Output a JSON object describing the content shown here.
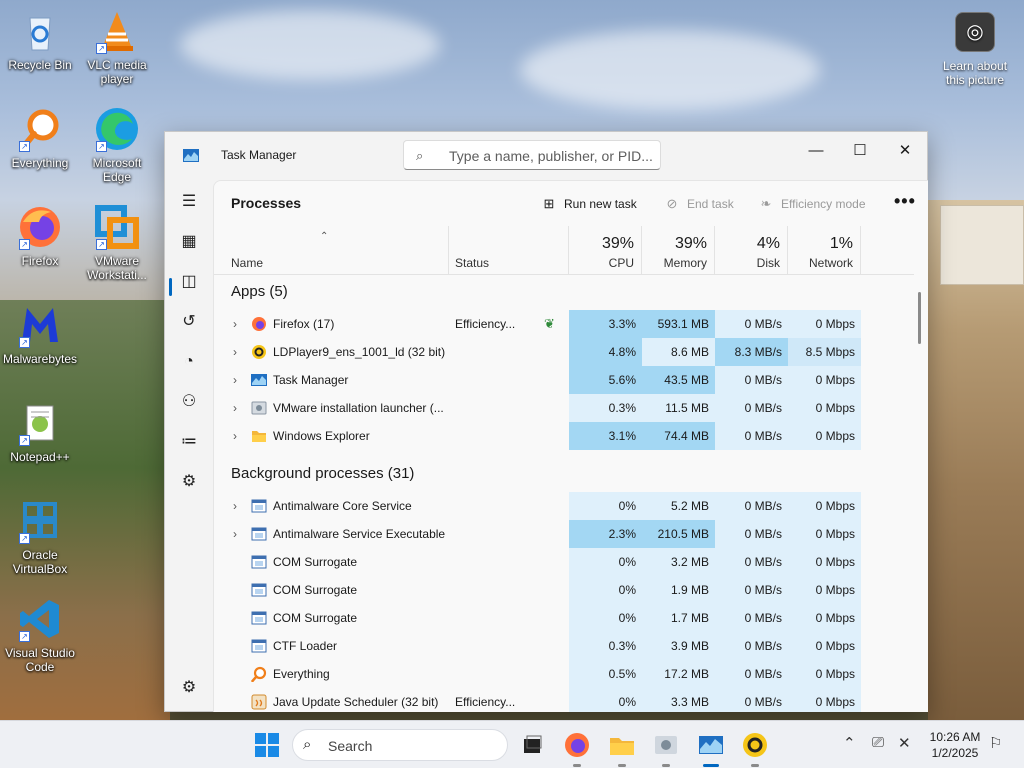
{
  "desktop": {
    "icons": [
      {
        "label": "Recycle Bin"
      },
      {
        "label": "VLC media player"
      },
      {
        "label": "Everything"
      },
      {
        "label": "Microsoft Edge"
      },
      {
        "label": "Firefox"
      },
      {
        "label": "VMware Workstati..."
      },
      {
        "label": "Malwarebytes"
      },
      {
        "label": "Notepad++"
      },
      {
        "label": "Oracle VirtualBox"
      },
      {
        "label": "Visual Studio Code"
      }
    ],
    "learn_picture": "Learn about this picture"
  },
  "window": {
    "title": "Task Manager",
    "search_placeholder": "Type a name, publisher, or PID...",
    "controls": {
      "minimize": "—",
      "maximize": "☐",
      "close": "✕"
    }
  },
  "toolbar": {
    "page_title": "Processes",
    "run_new_task": "Run new task",
    "end_task": "End task",
    "efficiency_mode": "Efficiency mode",
    "more": "•••"
  },
  "columns": {
    "name": "Name",
    "status": "Status",
    "cpu": {
      "pct": "39%",
      "label": "CPU"
    },
    "memory": {
      "pct": "39%",
      "label": "Memory"
    },
    "disk": {
      "pct": "4%",
      "label": "Disk"
    },
    "network": {
      "pct": "1%",
      "label": "Network"
    }
  },
  "groups": {
    "apps": "Apps (5)",
    "background": "Background processes (31)"
  },
  "apps": [
    {
      "name": "Firefox (17)",
      "status": "Efficiency...",
      "cpu": "3.3%",
      "memory": "593.1 MB",
      "disk": "0 MB/s",
      "network": "0 Mbps",
      "icon": "firefox-icon"
    },
    {
      "name": "LDPlayer9_ens_1001_ld (32 bit)",
      "status": "",
      "cpu": "4.8%",
      "memory": "8.6 MB",
      "disk": "8.3 MB/s",
      "network": "8.5 Mbps",
      "icon": "ldplayer-icon"
    },
    {
      "name": "Task Manager",
      "status": "",
      "cpu": "5.6%",
      "memory": "43.5 MB",
      "disk": "0 MB/s",
      "network": "0 Mbps",
      "icon": "task-manager-icon"
    },
    {
      "name": "VMware installation launcher (...",
      "status": "",
      "cpu": "0.3%",
      "memory": "11.5 MB",
      "disk": "0 MB/s",
      "network": "0 Mbps",
      "icon": "vmware-installer-icon"
    },
    {
      "name": "Windows Explorer",
      "status": "",
      "cpu": "3.1%",
      "memory": "74.4 MB",
      "disk": "0 MB/s",
      "network": "0 Mbps",
      "icon": "folder-icon"
    }
  ],
  "background": [
    {
      "name": "Antimalware Core Service",
      "status": "",
      "cpu": "0%",
      "memory": "5.2 MB",
      "disk": "0 MB/s",
      "network": "0 Mbps",
      "icon": "service-icon",
      "expandable": true
    },
    {
      "name": "Antimalware Service Executable",
      "status": "",
      "cpu": "2.3%",
      "memory": "210.5 MB",
      "disk": "0 MB/s",
      "network": "0 Mbps",
      "icon": "service-icon",
      "expandable": true
    },
    {
      "name": "COM Surrogate",
      "status": "",
      "cpu": "0%",
      "memory": "3.2 MB",
      "disk": "0 MB/s",
      "network": "0 Mbps",
      "icon": "service-icon"
    },
    {
      "name": "COM Surrogate",
      "status": "",
      "cpu": "0%",
      "memory": "1.9 MB",
      "disk": "0 MB/s",
      "network": "0 Mbps",
      "icon": "service-icon"
    },
    {
      "name": "COM Surrogate",
      "status": "",
      "cpu": "0%",
      "memory": "1.7 MB",
      "disk": "0 MB/s",
      "network": "0 Mbps",
      "icon": "service-icon"
    },
    {
      "name": "CTF Loader",
      "status": "",
      "cpu": "0.3%",
      "memory": "3.9 MB",
      "disk": "0 MB/s",
      "network": "0 Mbps",
      "icon": "service-icon"
    },
    {
      "name": "Everything",
      "status": "",
      "cpu": "0.5%",
      "memory": "17.2 MB",
      "disk": "0 MB/s",
      "network": "0 Mbps",
      "icon": "everything-icon"
    },
    {
      "name": "Java Update Scheduler (32 bit)",
      "status": "Efficiency...",
      "cpu": "0%",
      "memory": "3.3 MB",
      "disk": "0 MB/s",
      "network": "0 Mbps",
      "icon": "java-icon"
    }
  ],
  "taskbar": {
    "search_placeholder": "Search",
    "time": "10:26 AM",
    "date": "1/2/2025"
  },
  "colors": {
    "heat_low": "#dff0fb",
    "heat_mid": "#cfe8f8",
    "heat_high": "#a3d7f3",
    "accent": "#0067c0"
  }
}
